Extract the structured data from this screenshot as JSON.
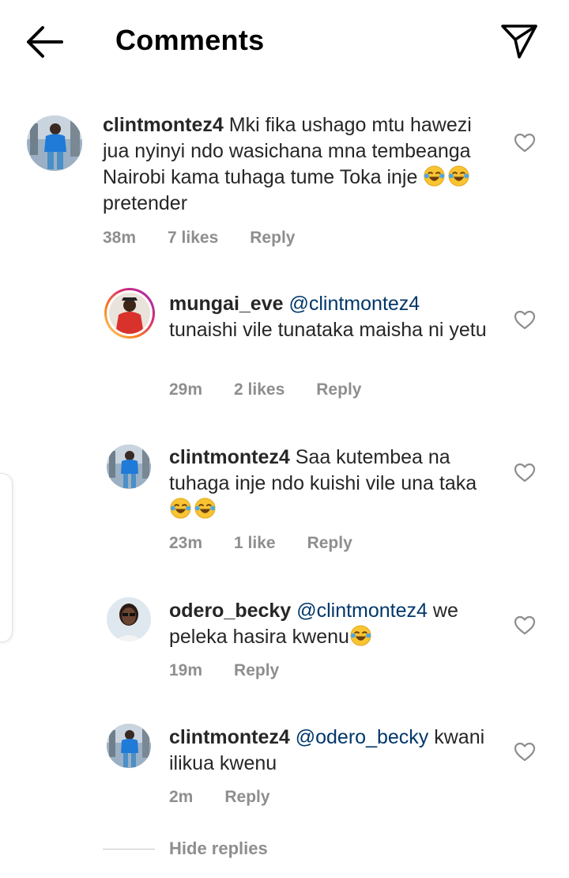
{
  "header": {
    "title": "Comments"
  },
  "comments": [
    {
      "username": "clintmontez4",
      "text": " Mki fika ushago mtu hawezi jua nyinyi ndo wasichana mna tembeanga Nairobi kama tuhaga tume Toka inje ",
      "text_after": " pretender",
      "time": "38m",
      "likes": "7 likes",
      "reply": "Reply"
    },
    {
      "username": "mungai_eve",
      "mention": "@clintmontez4",
      "text": "tunaishi vile tunataka maisha ni yetu",
      "time": "29m",
      "likes": "2 likes",
      "reply": "Reply"
    },
    {
      "username": "clintmontez4",
      "text": " Saa  kutembea na tuhaga inje ndo kuishi vile una taka",
      "time": "23m",
      "likes": "1 like",
      "reply": "Reply"
    },
    {
      "username": "odero_becky",
      "mention": "@clintmontez4",
      "text": "we peleka hasira kwenu",
      "time": "19m",
      "reply": "Reply"
    },
    {
      "username": "clintmontez4",
      "mention": "@odero_becky",
      "text": "kwani ilikua kwenu",
      "time": "2m",
      "reply": "Reply"
    }
  ],
  "hide_replies": "Hide replies",
  "colors": {
    "text": "#262626",
    "meta": "#8e8e8e",
    "mention": "#00376b",
    "story_ring": "#d6249f"
  },
  "icons": [
    "back-arrow-icon",
    "send-icon",
    "heart-icon",
    "laughing-emoji-icon"
  ]
}
